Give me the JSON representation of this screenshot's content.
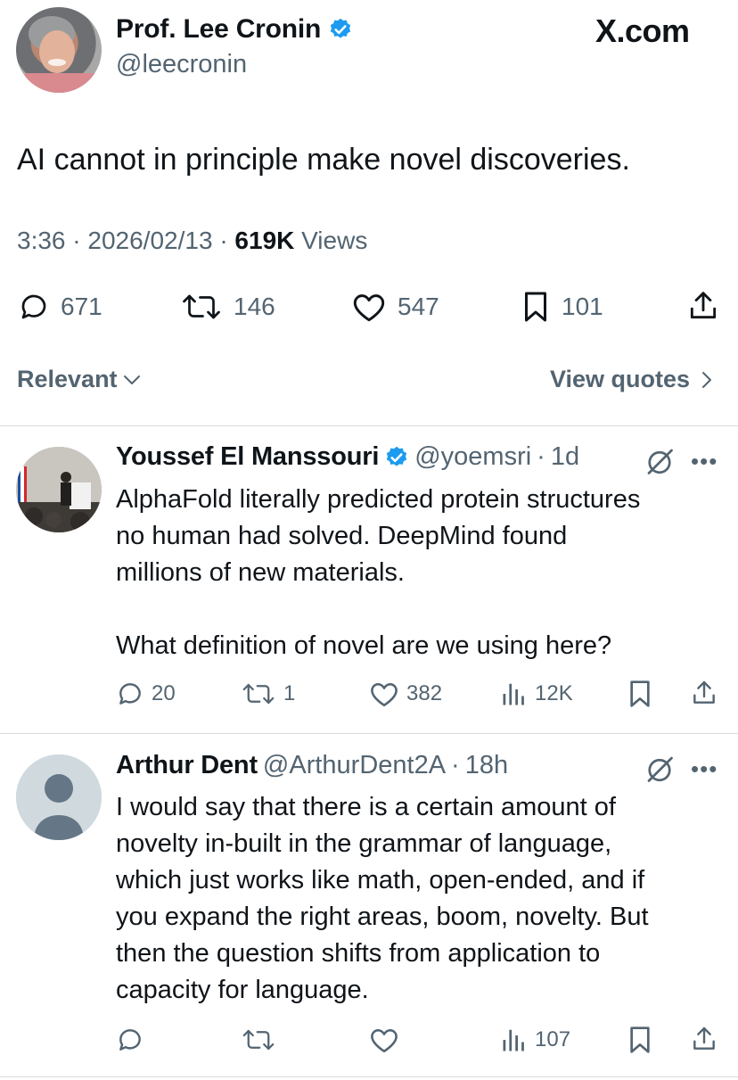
{
  "main": {
    "author_name": "Prof. Lee Cronin",
    "author_handle": "@leecronin",
    "site": "X.com",
    "text": "AI cannot in principle make novel discoveries.",
    "time": "3:36",
    "date": "2026/02/13",
    "views_count": "619K",
    "views_label": "Views",
    "replies": "671",
    "reposts": "146",
    "likes": "547",
    "bookmarks": "101"
  },
  "sort": {
    "label": "Relevant",
    "quotes_label": "View quotes"
  },
  "replies": [
    {
      "name": "Youssef El Manssouri",
      "handle": "@yoemsri",
      "time": "1d",
      "text": "AlphaFold literally predicted protein structures\nno human had solved. DeepMind found\nmillions of new materials.\n\nWhat definition of novel are we using here?",
      "replies": "20",
      "reposts": "1",
      "likes": "382",
      "views": "12K"
    },
    {
      "name": "Arthur Dent",
      "handle": "@ArthurDent2A",
      "time": "18h",
      "text": "I would say that there is a certain amount of\nnovelty in-built in the grammar of language,\nwhich just works like math, open-ended, and if\nyou expand the right areas, boom, novelty. But\nthen the question shifts from application to\ncapacity for language.",
      "views": "107"
    }
  ],
  "colors": {
    "verified": "#1d9bf0",
    "text": "#0f1419",
    "secondary": "#536471",
    "divider": "#d7dbde"
  },
  "icons": [
    "verified-badge-icon",
    "reply-icon",
    "repost-icon",
    "like-icon",
    "bookmark-icon",
    "share-icon",
    "views-icon",
    "grok-icon",
    "more-icon",
    "chevron-down-icon",
    "chevron-right-icon"
  ]
}
